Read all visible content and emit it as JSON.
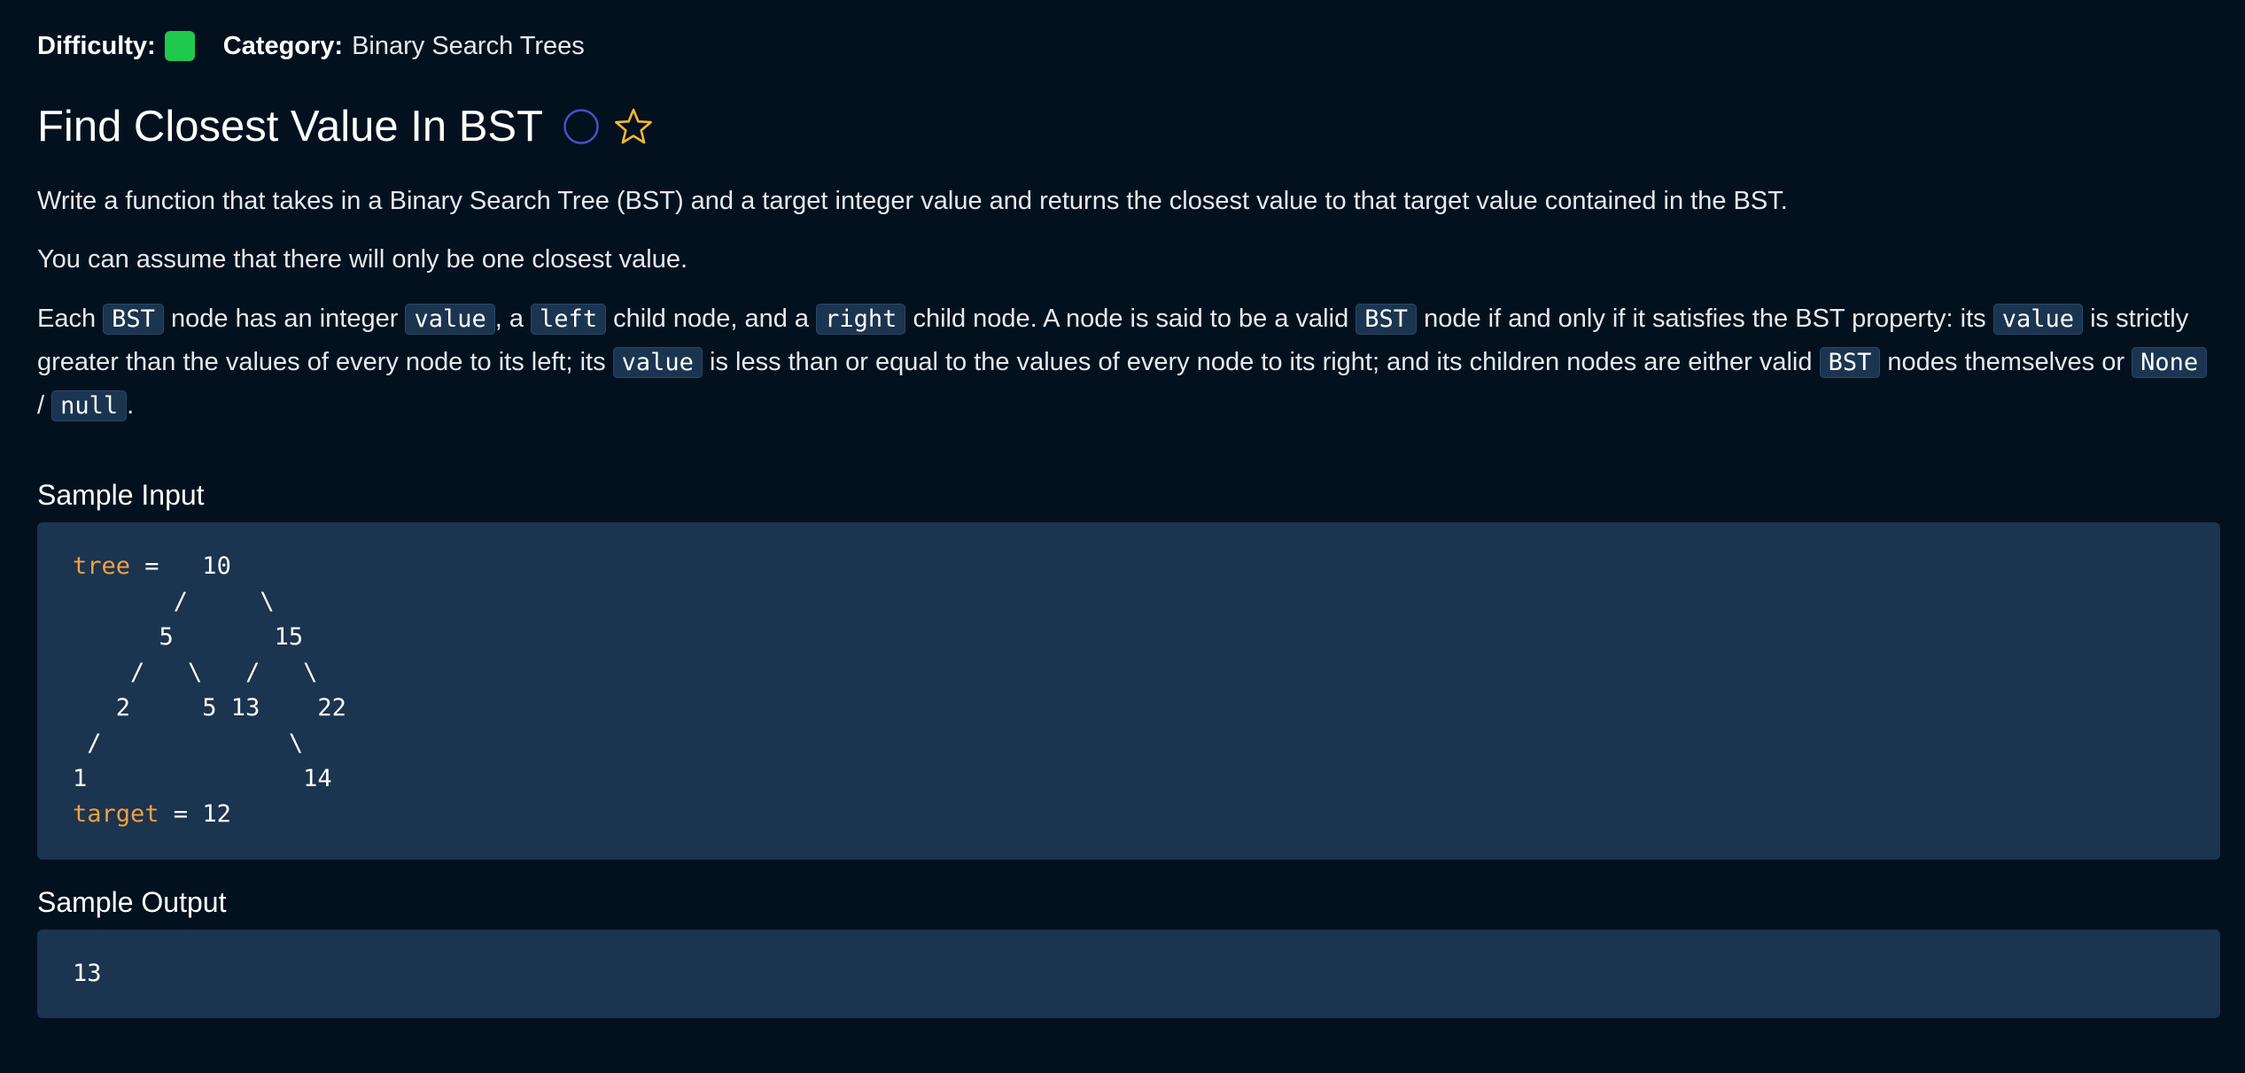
{
  "header": {
    "difficulty_label": "Difficulty:",
    "difficulty_color": "#1ec94b",
    "category_label": "Category:",
    "category_value": "Binary Search Trees"
  },
  "title": "Find Closest Value In BST",
  "icons": {
    "status": "circle-icon",
    "favorite": "star-icon"
  },
  "description": {
    "p1": "Write a function that takes in a Binary Search Tree (BST) and a target integer value and returns the closest value to that target value contained in the BST.",
    "p2": "You can assume that there will only be one closest value.",
    "p3": {
      "t1": "Each",
      "c1": "BST",
      "t2": "node has an integer",
      "c2": "value",
      "t3": ", a",
      "c3": "left",
      "t4": "child node, and a",
      "c4": "right",
      "t5": "child node. A node is said to be a valid",
      "c5": "BST",
      "t6": "node if and only if it satisfies the BST property: its",
      "c6": "value",
      "t7": "is strictly greater than the values of every node to its left; its",
      "c7": "value",
      "t8": "is less than or equal to the values of every node to its right; and its children nodes are either valid",
      "c8": "BST",
      "t9": "nodes themselves or",
      "c9": "None",
      "t10": "/",
      "c10": "null",
      "t11": "."
    }
  },
  "sample_input": {
    "heading": "Sample Input",
    "tree_keyword": "tree",
    "tree_first_line_rest": " =   10",
    "tree_lines": "       /     \\\n      5       15\n    /   \\   /   \\\n   2     5 13    22\n /             \\\n1               14",
    "target_keyword": "target",
    "target_rest": " = 12"
  },
  "sample_output": {
    "heading": "Sample Output",
    "value": "13"
  },
  "colors": {
    "background": "#03111f",
    "code_background": "#1b3450",
    "keyword": "#f0a040",
    "circle_icon": "#4a4fc9",
    "star_icon": "#f5b82e"
  }
}
